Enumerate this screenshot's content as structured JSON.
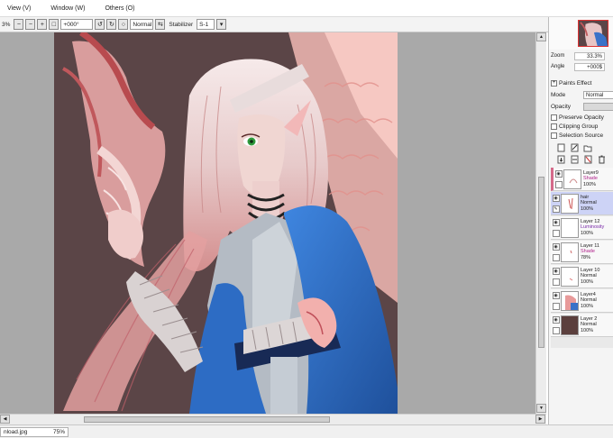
{
  "menu": {
    "items": [
      {
        "label": "View (V)"
      },
      {
        "label": "Window (W)"
      },
      {
        "label": "Others (O)"
      }
    ]
  },
  "toolbar": {
    "zoom_value": "3%",
    "rotation_value": "+000°",
    "blend_mode": "Normal",
    "stabilizer_label": "Stabilizer",
    "stabilizer_value": "S-1"
  },
  "navigator": {
    "zoom_label": "Zoom",
    "zoom_value": "33.3%",
    "angle_label": "Angle",
    "angle_value": "+000$"
  },
  "layer_panel": {
    "paints_effect_label": "Paints Effect",
    "mode_label": "Mode",
    "mode_value": "Normal",
    "opacity_label": "Opacity",
    "preserve_opacity_label": "Preserve Opacity",
    "clipping_group_label": "Clipping Group",
    "selection_source_label": "Selection Source",
    "layers": [
      {
        "name": "Layer9",
        "mode": "Shade",
        "opacity": "100%",
        "mode_color": "pink",
        "selected": false,
        "marked": true
      },
      {
        "name": "hair",
        "mode": "Normal",
        "opacity": "100%",
        "mode_color": "normal",
        "selected": true,
        "marked": false
      },
      {
        "name": "Layer 12",
        "mode": "Luminosity",
        "opacity": "100%",
        "mode_color": "purple",
        "selected": false,
        "marked": false
      },
      {
        "name": "Layer 11",
        "mode": "Shade",
        "opacity": "78%",
        "mode_color": "pink",
        "selected": false,
        "marked": false
      },
      {
        "name": "Layer 10",
        "mode": "Normal",
        "opacity": "100%",
        "mode_color": "normal",
        "selected": false,
        "marked": false
      },
      {
        "name": "Layer4",
        "mode": "Normal",
        "opacity": "100%",
        "mode_color": "normal",
        "selected": false,
        "marked": false
      },
      {
        "name": "Layer 2",
        "mode": "Normal",
        "opacity": "100%",
        "mode_color": "normal",
        "selected": false,
        "marked": false
      }
    ]
  },
  "status": {
    "filename": "nload.jpg",
    "zoom": "75%"
  },
  "colors": {
    "canvas_bg": "#a9a9a9",
    "artwork_bg": "#5b4547",
    "accent_blue": "#2b63b8",
    "accent_pink": "#e8a2a2",
    "selected_layer": "#cdd3f6"
  }
}
